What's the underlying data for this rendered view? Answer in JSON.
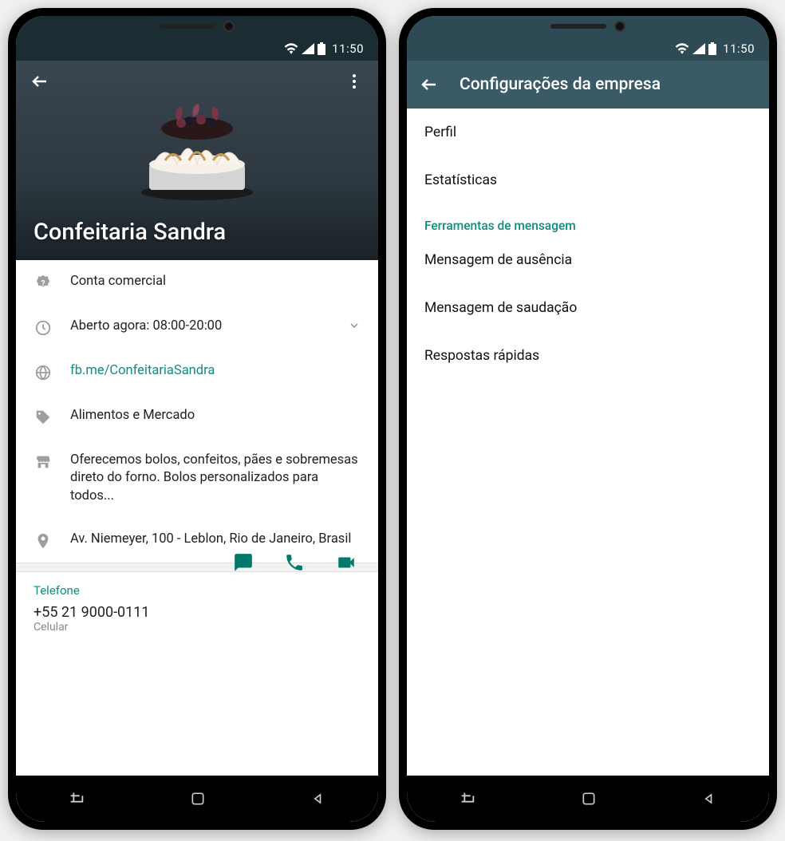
{
  "status": {
    "time": "11:50"
  },
  "phone1": {
    "hero_title": "Confeitaria Sandra",
    "rows": {
      "account_type": "Conta comercial",
      "hours": "Aberto agora: 08:00-20:00",
      "website": "fb.me/ConfeitariaSandra",
      "category": "Alimentos e Mercado",
      "description": "Oferecemos bolos, confeitos, pães e sobremesas direto do forno. Bolos personalizados para todos...",
      "address": "Av. Niemeyer, 100 - Leblon, Rio de Janeiro, Brasil"
    },
    "phone_section": {
      "label": "Telefone",
      "number": "+55 21 9000-0111",
      "type": "Celular"
    }
  },
  "phone2": {
    "appbar_title": "Configurações da empresa",
    "items": {
      "profile": "Perfil",
      "stats": "Estatísticas",
      "tools_header": "Ferramentas de mensagem",
      "away": "Mensagem de ausência",
      "greeting": "Mensagem de saudação",
      "quick": "Respostas rápidas"
    }
  }
}
